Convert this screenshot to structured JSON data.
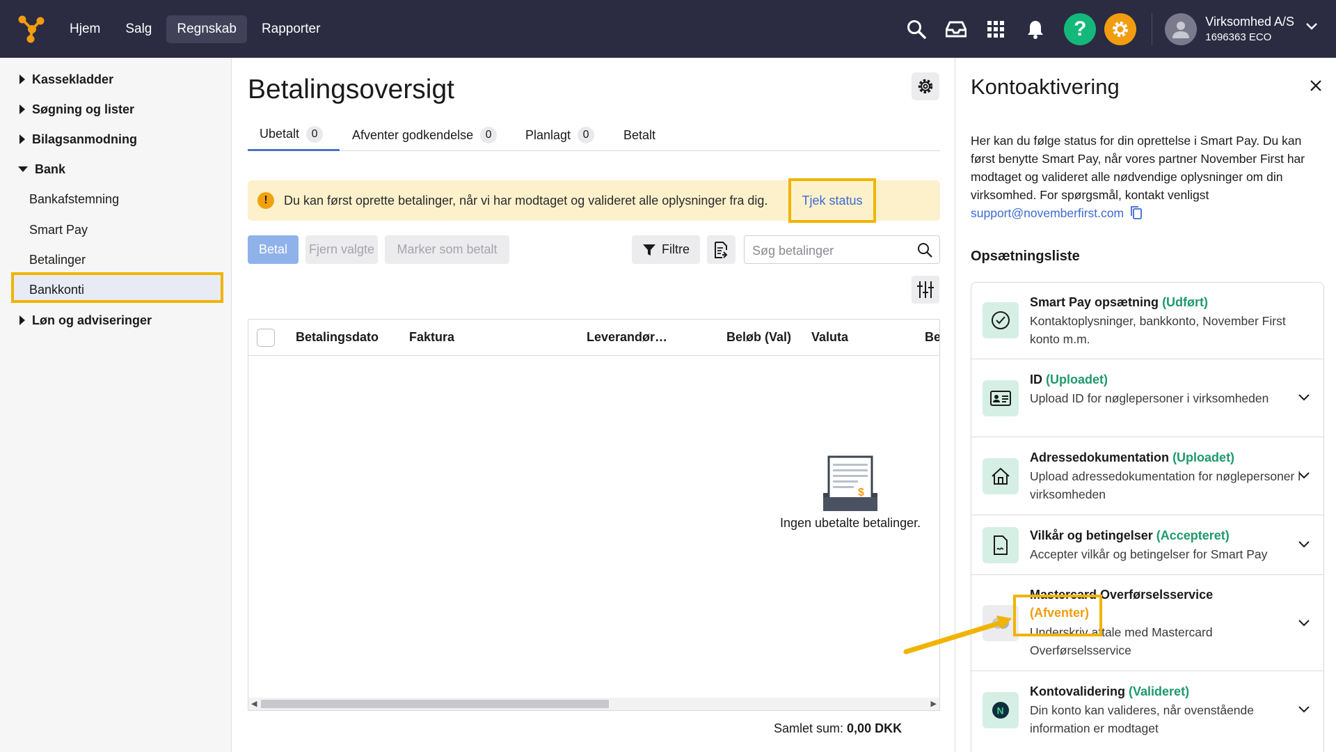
{
  "topbar": {
    "nav": [
      "Hjem",
      "Salg",
      "Regnskab",
      "Rapporter"
    ],
    "company_name": "Virksomhed A/S",
    "company_sub": "1696363 ECO"
  },
  "sidebar": {
    "items": [
      {
        "label": "Kassekladder",
        "type": "group"
      },
      {
        "label": "Søgning og lister",
        "type": "group"
      },
      {
        "label": "Bilagsanmodning",
        "type": "group"
      },
      {
        "label": "Bank",
        "type": "group-open"
      },
      {
        "label": "Bankafstemning",
        "type": "child"
      },
      {
        "label": "Smart Pay",
        "type": "child-selected"
      },
      {
        "label": "Betalinger",
        "type": "child"
      },
      {
        "label": "Bankkonti",
        "type": "child"
      },
      {
        "label": "Løn og adviseringer",
        "type": "group"
      }
    ]
  },
  "main": {
    "title": "Betalingsoversigt",
    "tabs": [
      {
        "label": "Ubetalt",
        "count": "0"
      },
      {
        "label": "Afventer godkendelse",
        "count": "0"
      },
      {
        "label": "Planlagt",
        "count": "0"
      },
      {
        "label": "Betalt",
        "count": ""
      }
    ],
    "alert_text": "Du kan først oprette betalinger, når vi har modtaget og valideret alle oplysninger fra dig.",
    "alert_link": "Tjek status",
    "buttons": {
      "pay": "Betal",
      "remove": "Fjern valgte",
      "mark": "Marker som betalt",
      "filter": "Filtre"
    },
    "search_placeholder": "Søg betalinger",
    "columns": [
      "Betalingsdato",
      "Faktura",
      "Leverandør…",
      "Beløb (Val)",
      "Valuta",
      "Be"
    ],
    "empty_text": "Ingen ubetalte betalinger.",
    "sum_label": "Samlet sum:",
    "sum_value": "0,00 DKK"
  },
  "panel": {
    "title": "Kontoaktivering",
    "desc": "Her kan du følge status for din oprettelse i Smart Pay. Du kan først benytte Smart Pay, når vores partner November First har modtaget og valideret alle nødvendige oplysninger om din virksomhed. For spørgsmål, kontakt venligst",
    "email": "support@novemberfirst.com",
    "setup_title": "Opsætningsliste",
    "steps": [
      {
        "title": "Smart Pay opsætning",
        "status": "(Udført)",
        "desc": "Kontaktoplysninger, bankkonto, November First konto m.m.",
        "icon": "check-circle-icon"
      },
      {
        "title": "ID",
        "status": "(Uploadet)",
        "desc": "Upload ID for nøglepersoner i virksomheden",
        "icon": "id-card-icon"
      },
      {
        "title": "Adressedokumentation",
        "status": "(Uploadet)",
        "desc": "Upload adressedokumentation for nøglepersoner i virksomheden",
        "icon": "house-icon"
      },
      {
        "title": "Vilkår og betingelser",
        "status": "(Accepteret)",
        "desc": "Accepter vilkår og betingelser for Smart Pay",
        "icon": "document-sign-icon"
      },
      {
        "title": "Mastercard Overførselsservice",
        "status": "(Afventer)",
        "desc": "Underskriv aftale med Mastercard Overførselsservice",
        "icon": "mastercard-icon"
      },
      {
        "title": "Kontovalidering",
        "status": "(Valideret)",
        "desc": "Din konto kan valideres, når ovenstående information er modtaget",
        "icon": "november-first-icon"
      }
    ]
  },
  "colors": {
    "topbar": "#2b2b42",
    "accent": "#3d6ad0",
    "success": "#1d9a6c",
    "pending": "#f29c0f",
    "highlight": "#f0b400"
  }
}
